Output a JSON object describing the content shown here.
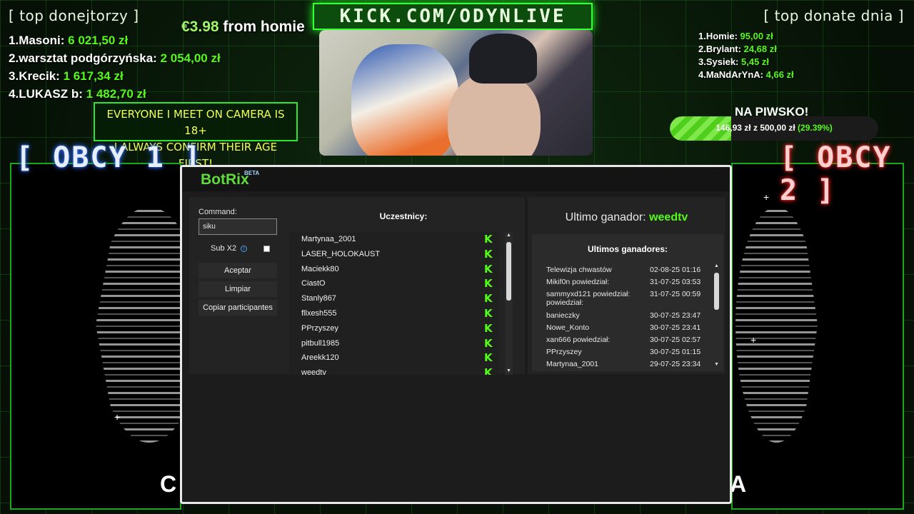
{
  "overlay": {
    "top_donors_title": "[ top donejtorzy ]",
    "top_donors": [
      {
        "rank": "1.",
        "name": "Masoni:",
        "amount": "6 021,50 zł"
      },
      {
        "rank": "2.",
        "name": "warsztat podgórzyńska:",
        "amount": "2 054,00 zł"
      },
      {
        "rank": "3.",
        "name": "Krecik:",
        "amount": "1 617,34 zł"
      },
      {
        "rank": "4.",
        "name": "LUKASZ b:",
        "amount": "1 482,70 zł"
      }
    ],
    "tip_amount": "€3.98",
    "tip_from": "from homie",
    "disclaimer_line1": "EVERYONE I MEET ON CAMERA IS 18+",
    "disclaimer_line2": "I ALWAYS CONFIRM THEIR AGE FIRST!",
    "kick_banner": "KICK.COM/ODYNLIVE",
    "top_donate_title": "[ top donate dnia ]",
    "top_donate_today": [
      {
        "rank": "1.",
        "name": "Homie:",
        "amount": "95,00 zł"
      },
      {
        "rank": "2.",
        "name": "Brylant:",
        "amount": "24,68 zł"
      },
      {
        "rank": "3.",
        "name": "Sysiek:",
        "amount": "5,45 zł"
      },
      {
        "rank": "4.",
        "name": "MaNdArYnA:",
        "amount": "4,66 zł"
      }
    ],
    "goal": {
      "title": "NA PIWSKO!",
      "current": "146,93 zł",
      "sep": "z",
      "target": "500,00 zł",
      "percent_text": "(29.39%)",
      "fill_fraction": 0.2939
    },
    "obcy_left": "[ OBCY 1 ]",
    "obcy_right": "[ OBCY 2 ]",
    "bottom_left_text": "C",
    "bottom_right_text": "A"
  },
  "botrix": {
    "logo": "BotRix",
    "beta": "BETA",
    "command_label": "Command:",
    "command_value": "siku",
    "sub_label": "Sub X2",
    "buttons": {
      "accept": "Aceptar",
      "clear": "Limpiar",
      "copy": "Copiar participantes"
    },
    "participants_title": "Uczestnicy:",
    "participants": [
      "Martynaa_2001",
      "LASER_HOLOKAUST",
      "Maciekk80",
      "CiastO",
      "Stanly867",
      "fllxesh555",
      "PPrzyszey",
      "pitbull1985",
      "Areekk120",
      "weedtv"
    ],
    "platform_badge": "K",
    "last_winner_label": "Ultimo ganador:",
    "last_winner_name": "weedtv",
    "winners_title": "Ultimos ganadores:",
    "winners": [
      {
        "name": "Telewizja chwastów",
        "date": "02-08-25 01:16"
      },
      {
        "name": "Mikif0n powiedział:",
        "date": "31-07-25 03:53"
      },
      {
        "name": "sammyxd121 powiedział: powiedział:",
        "date": "31-07-25 00:59"
      },
      {
        "name": "banieczky",
        "date": "30-07-25 23:47"
      },
      {
        "name": "Nowe_Konto",
        "date": "30-07-25 23:41"
      },
      {
        "name": "xan666 powiedział:",
        "date": "30-07-25 02:57"
      },
      {
        "name": "PPrzyszey",
        "date": "30-07-25 01:15"
      },
      {
        "name": "Martynaa_2001",
        "date": "29-07-25 23:34"
      }
    ],
    "colors": {
      "accent": "#53fc18",
      "window_bg": "#1c1c1c"
    }
  }
}
